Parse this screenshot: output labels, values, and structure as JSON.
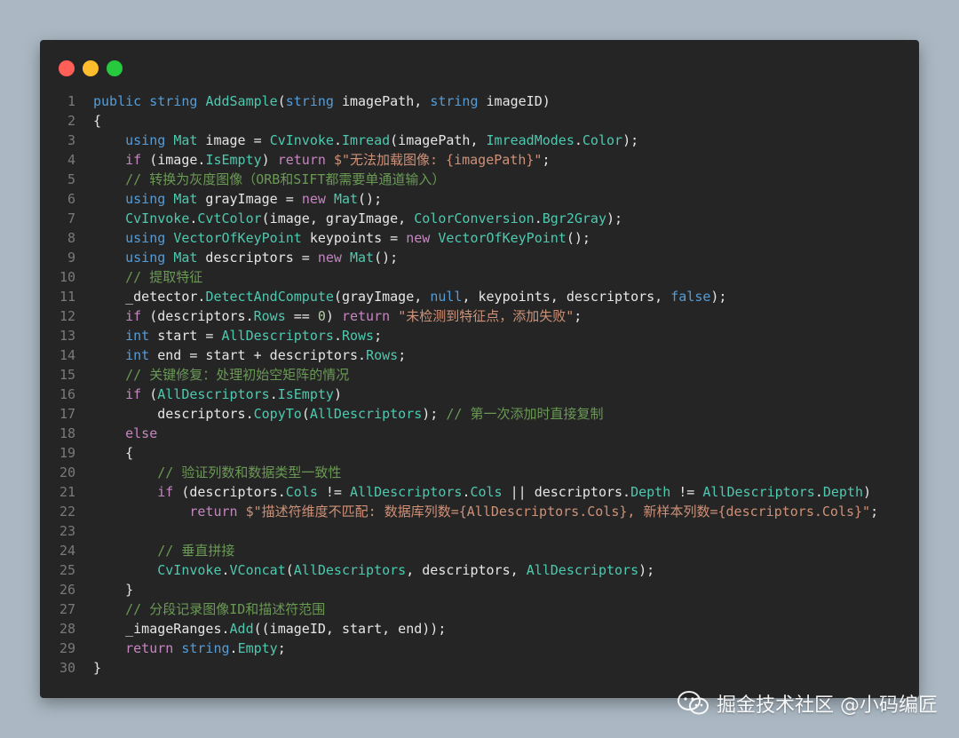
{
  "window": {
    "controls": {
      "close_color": "#ff5f56",
      "minimize_color": "#ffbd2e",
      "maximize_color": "#27c93f"
    }
  },
  "code": {
    "language": "csharp",
    "lines": [
      {
        "no": "1",
        "tokens": [
          [
            "kw2",
            "public"
          ],
          [
            "plain",
            " "
          ],
          [
            "kw2",
            "string"
          ],
          [
            "plain",
            " "
          ],
          [
            "fn",
            "AddSample"
          ],
          [
            "plain",
            "("
          ],
          [
            "kw2",
            "string"
          ],
          [
            "plain",
            " imagePath, "
          ],
          [
            "kw2",
            "string"
          ],
          [
            "plain",
            " imageID)"
          ]
        ]
      },
      {
        "no": "2",
        "tokens": [
          [
            "plain",
            "{"
          ]
        ]
      },
      {
        "no": "3",
        "tokens": [
          [
            "plain",
            "    "
          ],
          [
            "kw2",
            "using"
          ],
          [
            "plain",
            " "
          ],
          [
            "ty",
            "Mat"
          ],
          [
            "plain",
            " image = "
          ],
          [
            "ty",
            "CvInvoke"
          ],
          [
            "plain",
            "."
          ],
          [
            "fn",
            "Imread"
          ],
          [
            "plain",
            "(imagePath, "
          ],
          [
            "ty",
            "ImreadModes"
          ],
          [
            "plain",
            "."
          ],
          [
            "pr",
            "Color"
          ],
          [
            "plain",
            ");"
          ]
        ]
      },
      {
        "no": "4",
        "tokens": [
          [
            "plain",
            "    "
          ],
          [
            "kw",
            "if"
          ],
          [
            "plain",
            " (image."
          ],
          [
            "pr",
            "IsEmpty"
          ],
          [
            "plain",
            ") "
          ],
          [
            "kw",
            "return"
          ],
          [
            "plain",
            " "
          ],
          [
            "st",
            "$\"无法加载图像: {imagePath}\""
          ],
          [
            "plain",
            ";"
          ]
        ]
      },
      {
        "no": "5",
        "tokens": [
          [
            "plain",
            "    "
          ],
          [
            "cm",
            "// 转换为灰度图像（ORB和SIFT都需要单通道输入）"
          ]
        ]
      },
      {
        "no": "6",
        "tokens": [
          [
            "plain",
            "    "
          ],
          [
            "kw2",
            "using"
          ],
          [
            "plain",
            " "
          ],
          [
            "ty",
            "Mat"
          ],
          [
            "plain",
            " grayImage = "
          ],
          [
            "kw",
            "new"
          ],
          [
            "plain",
            " "
          ],
          [
            "ty",
            "Mat"
          ],
          [
            "plain",
            "();"
          ]
        ]
      },
      {
        "no": "7",
        "tokens": [
          [
            "plain",
            "    "
          ],
          [
            "ty",
            "CvInvoke"
          ],
          [
            "plain",
            "."
          ],
          [
            "fn",
            "CvtColor"
          ],
          [
            "plain",
            "(image, grayImage, "
          ],
          [
            "ty",
            "ColorConversion"
          ],
          [
            "plain",
            "."
          ],
          [
            "pr",
            "Bgr2Gray"
          ],
          [
            "plain",
            ");"
          ]
        ]
      },
      {
        "no": "8",
        "tokens": [
          [
            "plain",
            "    "
          ],
          [
            "kw2",
            "using"
          ],
          [
            "plain",
            " "
          ],
          [
            "ty",
            "VectorOfKeyPoint"
          ],
          [
            "plain",
            " keypoints = "
          ],
          [
            "kw",
            "new"
          ],
          [
            "plain",
            " "
          ],
          [
            "ty",
            "VectorOfKeyPoint"
          ],
          [
            "plain",
            "();"
          ]
        ]
      },
      {
        "no": "9",
        "tokens": [
          [
            "plain",
            "    "
          ],
          [
            "kw2",
            "using"
          ],
          [
            "plain",
            " "
          ],
          [
            "ty",
            "Mat"
          ],
          [
            "plain",
            " descriptors = "
          ],
          [
            "kw",
            "new"
          ],
          [
            "plain",
            " "
          ],
          [
            "ty",
            "Mat"
          ],
          [
            "plain",
            "();"
          ]
        ]
      },
      {
        "no": "10",
        "tokens": [
          [
            "plain",
            "    "
          ],
          [
            "cm",
            "// 提取特征"
          ]
        ]
      },
      {
        "no": "11",
        "tokens": [
          [
            "plain",
            "    _detector."
          ],
          [
            "fn",
            "DetectAndCompute"
          ],
          [
            "plain",
            "(grayImage, "
          ],
          [
            "kw2",
            "null"
          ],
          [
            "plain",
            ", keypoints, descriptors, "
          ],
          [
            "kw2",
            "false"
          ],
          [
            "plain",
            ");"
          ]
        ]
      },
      {
        "no": "12",
        "tokens": [
          [
            "plain",
            "    "
          ],
          [
            "kw",
            "if"
          ],
          [
            "plain",
            " (descriptors."
          ],
          [
            "pr",
            "Rows"
          ],
          [
            "plain",
            " == "
          ],
          [
            "nm",
            "0"
          ],
          [
            "plain",
            ") "
          ],
          [
            "kw",
            "return"
          ],
          [
            "plain",
            " "
          ],
          [
            "st",
            "\"未检测到特征点，添加失败\""
          ],
          [
            "plain",
            ";"
          ]
        ]
      },
      {
        "no": "13",
        "tokens": [
          [
            "plain",
            "    "
          ],
          [
            "kw2",
            "int"
          ],
          [
            "plain",
            " start = "
          ],
          [
            "ty",
            "AllDescriptors"
          ],
          [
            "plain",
            "."
          ],
          [
            "pr",
            "Rows"
          ],
          [
            "plain",
            ";"
          ]
        ]
      },
      {
        "no": "14",
        "tokens": [
          [
            "plain",
            "    "
          ],
          [
            "kw2",
            "int"
          ],
          [
            "plain",
            " end = start + descriptors."
          ],
          [
            "pr",
            "Rows"
          ],
          [
            "plain",
            ";"
          ]
        ]
      },
      {
        "no": "15",
        "tokens": [
          [
            "plain",
            "    "
          ],
          [
            "cm",
            "// 关键修复：处理初始空矩阵的情况"
          ]
        ]
      },
      {
        "no": "16",
        "tokens": [
          [
            "plain",
            "    "
          ],
          [
            "kw",
            "if"
          ],
          [
            "plain",
            " ("
          ],
          [
            "ty",
            "AllDescriptors"
          ],
          [
            "plain",
            "."
          ],
          [
            "pr",
            "IsEmpty"
          ],
          [
            "plain",
            ")"
          ]
        ]
      },
      {
        "no": "17",
        "tokens": [
          [
            "plain",
            "        descriptors."
          ],
          [
            "fn",
            "CopyTo"
          ],
          [
            "plain",
            "("
          ],
          [
            "ty",
            "AllDescriptors"
          ],
          [
            "plain",
            "); "
          ],
          [
            "cm",
            "// 第一次添加时直接复制"
          ]
        ]
      },
      {
        "no": "18",
        "tokens": [
          [
            "plain",
            "    "
          ],
          [
            "kw",
            "else"
          ]
        ]
      },
      {
        "no": "19",
        "tokens": [
          [
            "plain",
            "    {"
          ]
        ]
      },
      {
        "no": "20",
        "tokens": [
          [
            "plain",
            "        "
          ],
          [
            "cm",
            "// 验证列数和数据类型一致性"
          ]
        ]
      },
      {
        "no": "21",
        "tokens": [
          [
            "plain",
            "        "
          ],
          [
            "kw",
            "if"
          ],
          [
            "plain",
            " (descriptors."
          ],
          [
            "pr",
            "Cols"
          ],
          [
            "plain",
            " != "
          ],
          [
            "ty",
            "AllDescriptors"
          ],
          [
            "plain",
            "."
          ],
          [
            "pr",
            "Cols"
          ],
          [
            "plain",
            " || descriptors."
          ],
          [
            "pr",
            "Depth"
          ],
          [
            "plain",
            " != "
          ],
          [
            "ty",
            "AllDescriptors"
          ],
          [
            "plain",
            "."
          ],
          [
            "pr",
            "Depth"
          ],
          [
            "plain",
            ")"
          ]
        ]
      },
      {
        "no": "22",
        "tokens": [
          [
            "plain",
            "            "
          ],
          [
            "kw",
            "return"
          ],
          [
            "plain",
            " "
          ],
          [
            "st",
            "$\"描述符维度不匹配: 数据库列数={AllDescriptors.Cols}, 新样本列数={descriptors.Cols}\""
          ],
          [
            "plain",
            ";"
          ]
        ]
      },
      {
        "no": "23",
        "tokens": [
          [
            "plain",
            ""
          ]
        ]
      },
      {
        "no": "24",
        "tokens": [
          [
            "plain",
            "        "
          ],
          [
            "cm",
            "// 垂直拼接"
          ]
        ]
      },
      {
        "no": "25",
        "tokens": [
          [
            "plain",
            "        "
          ],
          [
            "ty",
            "CvInvoke"
          ],
          [
            "plain",
            "."
          ],
          [
            "fn",
            "VConcat"
          ],
          [
            "plain",
            "("
          ],
          [
            "ty",
            "AllDescriptors"
          ],
          [
            "plain",
            ", descriptors, "
          ],
          [
            "ty",
            "AllDescriptors"
          ],
          [
            "plain",
            ");"
          ]
        ]
      },
      {
        "no": "26",
        "tokens": [
          [
            "plain",
            "    }"
          ]
        ]
      },
      {
        "no": "27",
        "tokens": [
          [
            "plain",
            "    "
          ],
          [
            "cm",
            "// 分段记录图像ID和描述符范围"
          ]
        ]
      },
      {
        "no": "28",
        "tokens": [
          [
            "plain",
            "    _imageRanges."
          ],
          [
            "fn",
            "Add"
          ],
          [
            "plain",
            "((imageID, start, end));"
          ]
        ]
      },
      {
        "no": "29",
        "tokens": [
          [
            "plain",
            "    "
          ],
          [
            "kw",
            "return"
          ],
          [
            "plain",
            " "
          ],
          [
            "kw2",
            "string"
          ],
          [
            "plain",
            "."
          ],
          [
            "pr",
            "Empty"
          ],
          [
            "plain",
            ";"
          ]
        ]
      },
      {
        "no": "30",
        "tokens": [
          [
            "plain",
            "}"
          ]
        ]
      }
    ]
  },
  "watermark": {
    "text": "掘金技术社区 @小码编匠",
    "icon": "wechat-icon"
  }
}
